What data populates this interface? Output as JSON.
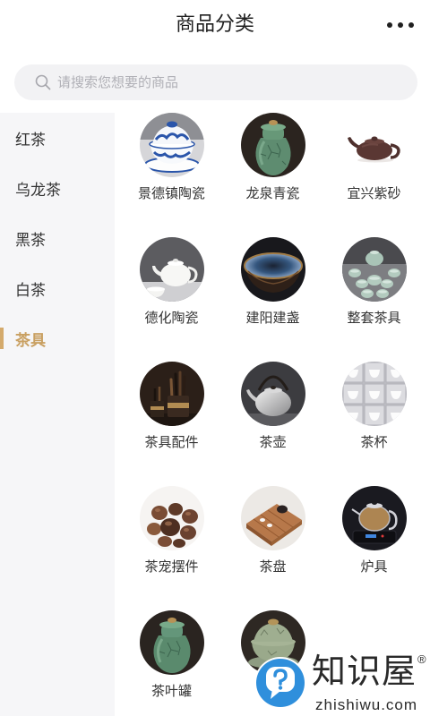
{
  "header": {
    "title": "商品分类",
    "more_icon": "more-dots-icon"
  },
  "search": {
    "placeholder": "请搜索您想要的商品",
    "icon": "search-icon"
  },
  "sidebar": {
    "items": [
      {
        "label": "红茶"
      },
      {
        "label": "乌龙茶"
      },
      {
        "label": "黑茶"
      },
      {
        "label": "白茶"
      },
      {
        "label": "茶具",
        "selected": true
      }
    ]
  },
  "categories": [
    {
      "label": "景德镇陶瓷",
      "image": "blue-white-gaiwan-photo"
    },
    {
      "label": "龙泉青瓷",
      "image": "green-celadon-jar-photo"
    },
    {
      "label": "宜兴紫砂",
      "image": "purple-clay-teapot-photo"
    },
    {
      "label": "德化陶瓷",
      "image": "white-porcelain-teapot-photo"
    },
    {
      "label": "建阳建盏",
      "image": "tenmoku-bowl-photo"
    },
    {
      "label": "整套茶具",
      "image": "celadon-tea-set-photo"
    },
    {
      "label": "茶具配件",
      "image": "tea-utensils-photo"
    },
    {
      "label": "茶壶",
      "image": "silver-kettle-photo"
    },
    {
      "label": "茶杯",
      "image": "white-cups-grid-photo"
    },
    {
      "label": "茶宠摆件",
      "image": "clay-tea-pets-photo"
    },
    {
      "label": "茶盘",
      "image": "wooden-tea-tray-photo"
    },
    {
      "label": "炉具",
      "image": "glass-kettle-stove-photo"
    },
    {
      "label": "茶叶罐",
      "image": "green-tea-canister-photo"
    },
    {
      "image": "celadon-gaiwan-photo"
    }
  ],
  "watermark": {
    "brand": "知识屋",
    "mark": "®",
    "domain": "zhishiwu.com",
    "logo": "zhishiwu-logo-icon"
  },
  "colors": {
    "accent": "#c9a062",
    "accent_bar": "#d4aa6c",
    "text": "#222222",
    "sidebar_bg": "#f6f6f8",
    "search_bg": "#f2f2f4",
    "placeholder": "#b0b0b6",
    "watermark_blue": "#2f8fdc"
  }
}
